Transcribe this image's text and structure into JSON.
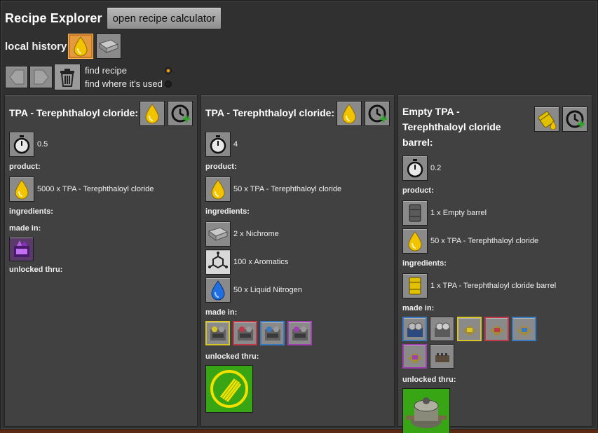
{
  "window": {
    "title": "Recipe Explorer",
    "calculator_button": "open recipe calculator"
  },
  "history": {
    "label": "local history",
    "items": [
      {
        "icon": "tpa-fluid-icon",
        "active": true
      },
      {
        "icon": "nichrome-plate-icon",
        "active": false
      }
    ]
  },
  "nav": {
    "back_icon": "back-arrow-icon",
    "forward_icon": "forward-arrow-icon",
    "trash_icon": "trash-icon",
    "modes": [
      {
        "label": "find recipe",
        "selected": true
      },
      {
        "label": "find where it's used",
        "selected": false
      }
    ]
  },
  "labels": {
    "product": "product:",
    "ingredients": "ingredients:",
    "made_in": "made in:",
    "unlocked_thru": "unlocked thru:"
  },
  "panels": [
    {
      "title": "TPA - Terephthaloyl cloride:",
      "time": "0.5",
      "products": [
        {
          "icon": "tpa-fluid-icon",
          "text": "5000 x TPA - Terephthaloyl cloride"
        }
      ],
      "ingredients": [],
      "made_in": [
        {
          "icon": "purple-crystal-machine-icon",
          "color": "#7a3aa8"
        }
      ],
      "unlocked_thru": []
    },
    {
      "title": "TPA - Terephthaloyl cloride:",
      "time": "4",
      "products": [
        {
          "icon": "tpa-fluid-icon",
          "text": "50 x TPA - Terephthaloyl cloride"
        }
      ],
      "ingredients": [
        {
          "icon": "nichrome-plate-icon",
          "text": "2 x Nichrome"
        },
        {
          "icon": "aromatics-molecule-icon",
          "text": "100 x Aromatics"
        },
        {
          "icon": "liquid-nitrogen-icon",
          "text": "50 x Liquid Nitrogen"
        }
      ],
      "made_in": [
        {
          "icon": "chemical-plant-yellow-icon",
          "color": "#d8c52a"
        },
        {
          "icon": "chemical-plant-red-icon",
          "color": "#c0384a"
        },
        {
          "icon": "chemical-plant-blue-icon",
          "color": "#3a78c0"
        },
        {
          "icon": "chemical-plant-purple-icon",
          "color": "#a040b0"
        }
      ],
      "unlocked_thru": [
        {
          "icon": "fiber-optic-technology-icon",
          "color": "#37a514"
        }
      ]
    },
    {
      "title": "Empty TPA - Terephthaloyl cloride barrel:",
      "time": "0.2",
      "products": [
        {
          "icon": "empty-barrel-icon",
          "text": "1 x Empty barrel"
        },
        {
          "icon": "tpa-fluid-icon",
          "text": "50 x TPA - Terephthaloyl cloride"
        }
      ],
      "ingredients": [
        {
          "icon": "tpa-barrel-icon",
          "text": "1 x TPA - Terephthaloyl cloride barrel"
        }
      ],
      "made_in": [
        {
          "icon": "assembler-blue-icon",
          "color": "#3a78c0"
        },
        {
          "icon": "assembler-grey-icon",
          "color": "#909090"
        },
        {
          "icon": "automated-factory-yellow-icon",
          "color": "#d8c52a"
        },
        {
          "icon": "automated-factory-red-icon",
          "color": "#c0384a"
        },
        {
          "icon": "automated-factory-blue-icon",
          "color": "#3a78c0"
        },
        {
          "icon": "automated-factory-purple-icon",
          "color": "#a040b0"
        },
        {
          "icon": "burner-assembler-icon",
          "color": "#707070"
        }
      ],
      "unlocked_thru": [
        {
          "icon": "fluid-handling-technology-icon",
          "color": "#37a514"
        }
      ]
    }
  ],
  "colors": {
    "window_bg": "#313031",
    "panel_bg": "#414141",
    "active_slot": "#e59b3c",
    "tech_green": "#37a514",
    "fluid_yellow": "#f2c400"
  }
}
